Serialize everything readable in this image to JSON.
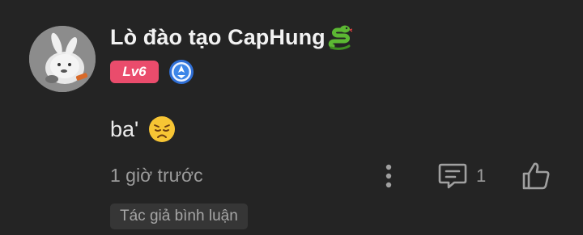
{
  "comment": {
    "username": "Lò đào tạo CapHung",
    "username_emoji": "snake-icon",
    "level_badge": "Lv6",
    "level_badge_color": "#ea4c6c",
    "verified_badge": "verified-icon",
    "text": "ba'",
    "text_emoji": "disappointed-face-icon",
    "timestamp": "1 giờ trước",
    "reply_count": "1",
    "author_tag": "Tác giả bình luận"
  },
  "colors": {
    "background": "#242424",
    "primary_text": "#ececec",
    "secondary_text": "#9b9b9b",
    "chip_background": "#363636"
  }
}
